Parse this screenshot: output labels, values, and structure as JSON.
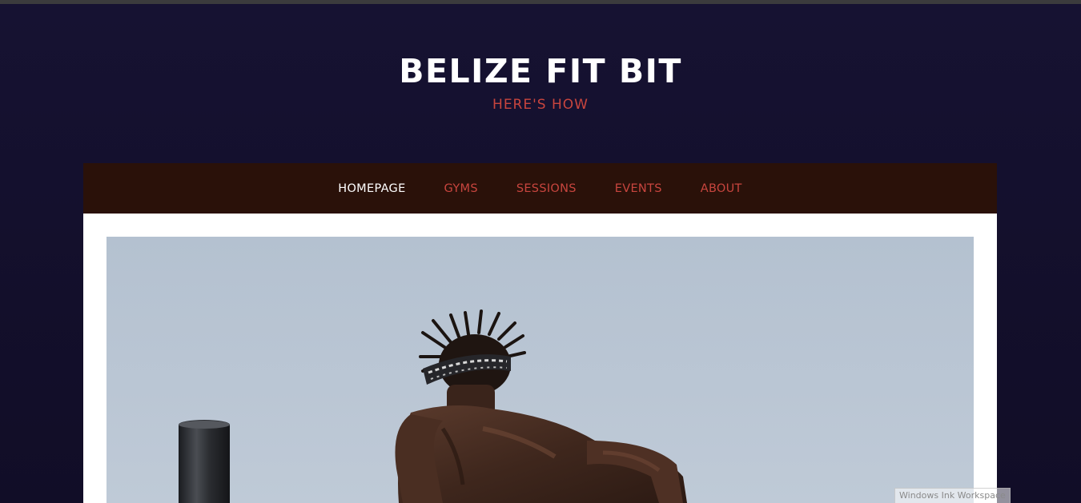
{
  "site": {
    "title": "BELIZE FIT BIT",
    "tagline": "HERE'S HOW"
  },
  "nav": {
    "items": [
      {
        "label": "HOMEPAGE",
        "active": true
      },
      {
        "label": "GYMS",
        "active": false
      },
      {
        "label": "SESSIONS",
        "active": false
      },
      {
        "label": "EVENTS",
        "active": false
      },
      {
        "label": "ABOUT",
        "active": false
      }
    ]
  },
  "hero": {
    "image": "athlete-dips-photo"
  },
  "watermark": {
    "label": "Windows Ink Workspace"
  },
  "colors": {
    "background": "#14112e",
    "navbar": "#2a1109",
    "accent": "#c8453e",
    "title": "#ffffff",
    "sky": "#b9c5d3"
  }
}
